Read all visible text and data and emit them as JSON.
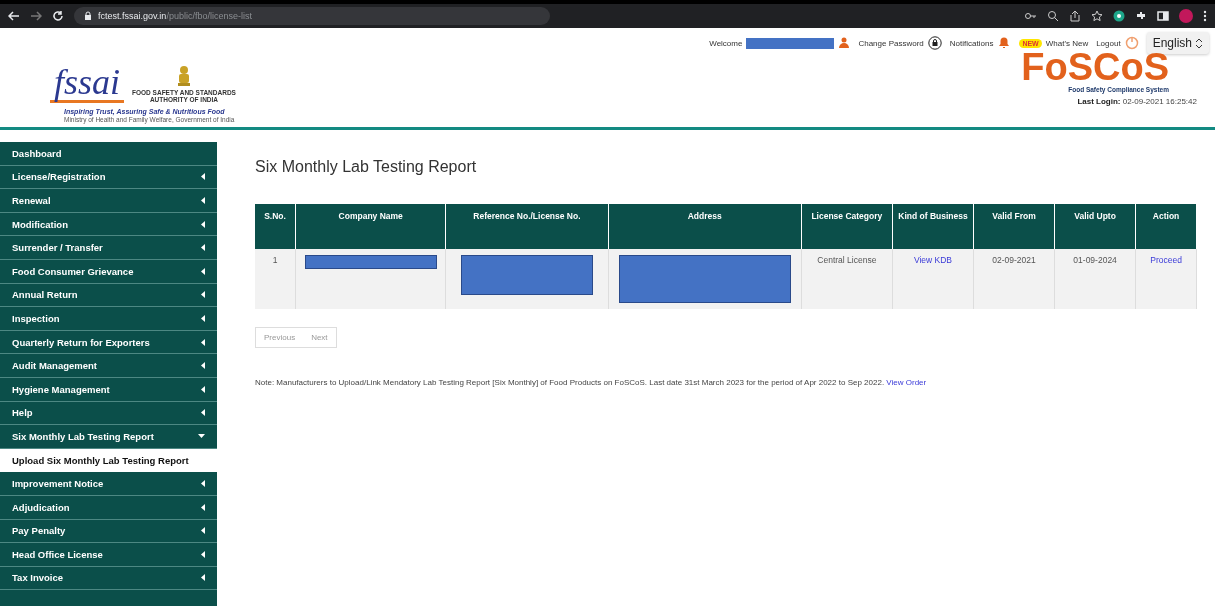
{
  "browser": {
    "url_host": "fctest.fssai.gov.in",
    "url_path": "/public/fbo/license-list"
  },
  "header": {
    "org_line_1": "FOOD SAFETY AND STANDARDS",
    "org_line_2": "AUTHORITY OF INDIA",
    "logo_text": "fssai",
    "tagline": "Inspiring Trust, Assuring Safe & Nutritious Food",
    "ministry": "Ministry of Health and Family Welfare, Government of India",
    "welcome": "Welcome",
    "links": [
      {
        "label": "Change Password",
        "kind": "password"
      },
      {
        "label": "Notifications",
        "kind": "notifications"
      },
      {
        "label": "What's New",
        "kind": "news"
      },
      {
        "label": "Logout",
        "kind": "logout"
      }
    ],
    "new_badge": "NEW",
    "language": "English",
    "brand": "FoSCoS",
    "brand_subtitle": "Food Safety Compliance System",
    "last_login_label": "Last Login:",
    "last_login_value": "02-09-2021 16:25:42"
  },
  "sidebar": {
    "items": [
      {
        "label": "Dashboard",
        "kind": "link"
      },
      {
        "label": "License/Registration",
        "kind": "menu",
        "expanded": false
      },
      {
        "label": "Renewal",
        "kind": "menu",
        "expanded": false
      },
      {
        "label": "Modification",
        "kind": "menu",
        "expanded": false
      },
      {
        "label": "Surrender / Transfer",
        "kind": "menu",
        "expanded": false
      },
      {
        "label": "Food Consumer Grievance",
        "kind": "menu",
        "expanded": false
      },
      {
        "label": "Annual Return",
        "kind": "menu",
        "expanded": false
      },
      {
        "label": "Inspection",
        "kind": "menu",
        "expanded": false
      },
      {
        "label": "Quarterly Return for Exporters",
        "kind": "menu",
        "expanded": false
      },
      {
        "label": "Audit Management",
        "kind": "menu",
        "expanded": false
      },
      {
        "label": "Hygiene Management",
        "kind": "menu",
        "expanded": false
      },
      {
        "label": "Help",
        "kind": "menu",
        "expanded": false
      },
      {
        "label": "Six Monthly Lab Testing Report",
        "kind": "menu",
        "expanded": true,
        "children": [
          {
            "label": "Upload Six Monthly Lab Testing Report",
            "selected": true
          }
        ]
      },
      {
        "label": "Improvement Notice",
        "kind": "menu",
        "expanded": false
      },
      {
        "label": "Adjudication",
        "kind": "menu",
        "expanded": false
      },
      {
        "label": "Pay Penalty",
        "kind": "menu",
        "expanded": false
      },
      {
        "label": "Head Office License",
        "kind": "menu",
        "expanded": false
      },
      {
        "label": "Tax Invoice",
        "kind": "menu",
        "expanded": false
      }
    ]
  },
  "page_title": "Six Monthly Lab Testing Report",
  "table": {
    "columns": [
      "S.No.",
      "Company Name",
      "Reference No./License No.",
      "Address",
      "License Category",
      "Kind of Business",
      "Valid From",
      "Valid Upto",
      "Action"
    ],
    "rows": [
      [
        {
          "kind": "text",
          "text": "1"
        },
        {
          "kind": "redacted"
        },
        {
          "kind": "redacted"
        },
        {
          "kind": "redacted"
        },
        {
          "kind": "text",
          "text": "Central License"
        },
        {
          "kind": "link",
          "text": "View KDB"
        },
        {
          "kind": "text",
          "text": "02-09-2021"
        },
        {
          "kind": "text",
          "text": "01-09-2024"
        },
        {
          "kind": "link",
          "text": "Proceed"
        }
      ]
    ]
  },
  "pagination": [
    {
      "label": "Previous"
    },
    {
      "label": "Next"
    }
  ],
  "note": {
    "text": "Note: Manufacturers to Upload/Link Mendatory Lab Testing Report [Six Monthly] of Food Products on FoSCoS. Last date 31st March 2023 for the period of Apr 2022 to Sep 2022.",
    "link": "View Order"
  }
}
